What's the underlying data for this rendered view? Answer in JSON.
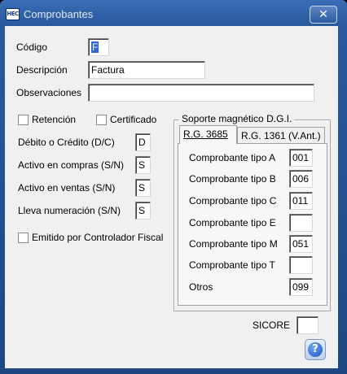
{
  "window": {
    "title": "Comprobantes",
    "app_icon_text": "HEC",
    "close_glyph": "✕"
  },
  "form": {
    "codigo": {
      "label": "Código",
      "value": "F"
    },
    "descripcion": {
      "label": "Descripción",
      "value": "Factura"
    },
    "observaciones": {
      "label": "Observaciones",
      "value": ""
    },
    "retencion": {
      "label": "Retención",
      "checked": false
    },
    "certificado": {
      "label": "Certificado",
      "checked": false
    },
    "debito_credito": {
      "label": "Débito o Crédito (D/C)",
      "value": "D"
    },
    "activo_compras": {
      "label": "Activo en compras (S/N)",
      "value": "S"
    },
    "activo_ventas": {
      "label": "Activo en ventas (S/N)",
      "value": "S"
    },
    "lleva_numeracion": {
      "label": "Lleva numeración (S/N)",
      "value": "S"
    },
    "emitido_controlador": {
      "label": "Emitido por Controlador Fiscal",
      "checked": false
    },
    "sicore": {
      "label": "SICORE",
      "value": ""
    }
  },
  "soporte": {
    "title": "Soporte magnético D.G.I.",
    "tabs": [
      {
        "label": "R.G. 3685",
        "active": true
      },
      {
        "label": "R.G. 1361 (V.Ant.)",
        "active": false
      }
    ],
    "rows": [
      {
        "label": "Comprobante tipo A",
        "value": "001"
      },
      {
        "label": "Comprobante tipo B",
        "value": "006"
      },
      {
        "label": "Comprobante tipo C",
        "value": "011"
      },
      {
        "label": "Comprobante tipo E",
        "value": ""
      },
      {
        "label": "Comprobante tipo M",
        "value": "051"
      },
      {
        "label": "Comprobante tipo T",
        "value": ""
      },
      {
        "label": "Otros",
        "value": "099"
      }
    ]
  },
  "help": {
    "glyph": "?"
  }
}
